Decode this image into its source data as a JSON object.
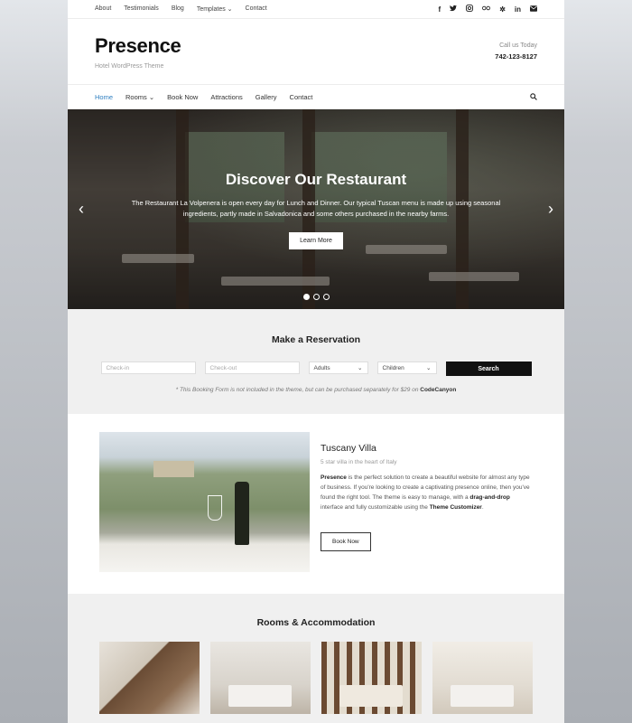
{
  "topbar": {
    "nav": [
      "About",
      "Testimonials",
      "Blog",
      "Templates ⌄",
      "Contact"
    ],
    "social_icons": [
      "facebook-icon",
      "twitter-icon",
      "instagram-icon",
      "tripadvisor-icon",
      "yelp-icon",
      "linkedin-icon",
      "mail-icon"
    ]
  },
  "header": {
    "site_title": "Presence",
    "tagline": "Hotel WordPress Theme",
    "call_label": "Call us Today",
    "phone": "742-123-8127"
  },
  "mainnav": {
    "items": [
      "Home",
      "Rooms ⌄",
      "Book Now",
      "Attractions",
      "Gallery",
      "Contact"
    ],
    "active": "Home"
  },
  "hero": {
    "title": "Discover Our Restaurant",
    "text": "The Restaurant La Volpenera is open every day for Lunch and Dinner. Our typical Tuscan menu is made up using seasonal ingredients, partly made in Salvadonica and some others purchased in the nearby farms.",
    "button": "Learn More",
    "prev": "‹",
    "next": "›"
  },
  "reservation": {
    "title": "Make a Reservation",
    "checkin_placeholder": "Check-in",
    "checkout_placeholder": "Check-out",
    "adults": "Adults",
    "children": "Children",
    "search": "Search",
    "note_text": "* This Booking Form is not included in the theme, but can be purchased separately for $29 on",
    "note_link": "CodeCanyon"
  },
  "villa": {
    "title": "Tuscany Villa",
    "subtitle": "5 star villa in the heart of Italy",
    "desc_bold1": "Presence",
    "desc_text1": " is the perfect solution to create a beautiful website for almost any type of business. If you're looking to create a captivating presence online, then you've found the right tool. The theme is easy to manage, with a ",
    "desc_bold2": "drag-and-drop",
    "desc_text2": " interface and fully customizable using the ",
    "desc_bold3": "Theme Customizer",
    "desc_text3": ".",
    "button": "Book Now"
  },
  "rooms": {
    "title": "Rooms & Accommodation"
  },
  "colors": {
    "accent": "#2f7fc1",
    "dark": "#111111"
  }
}
